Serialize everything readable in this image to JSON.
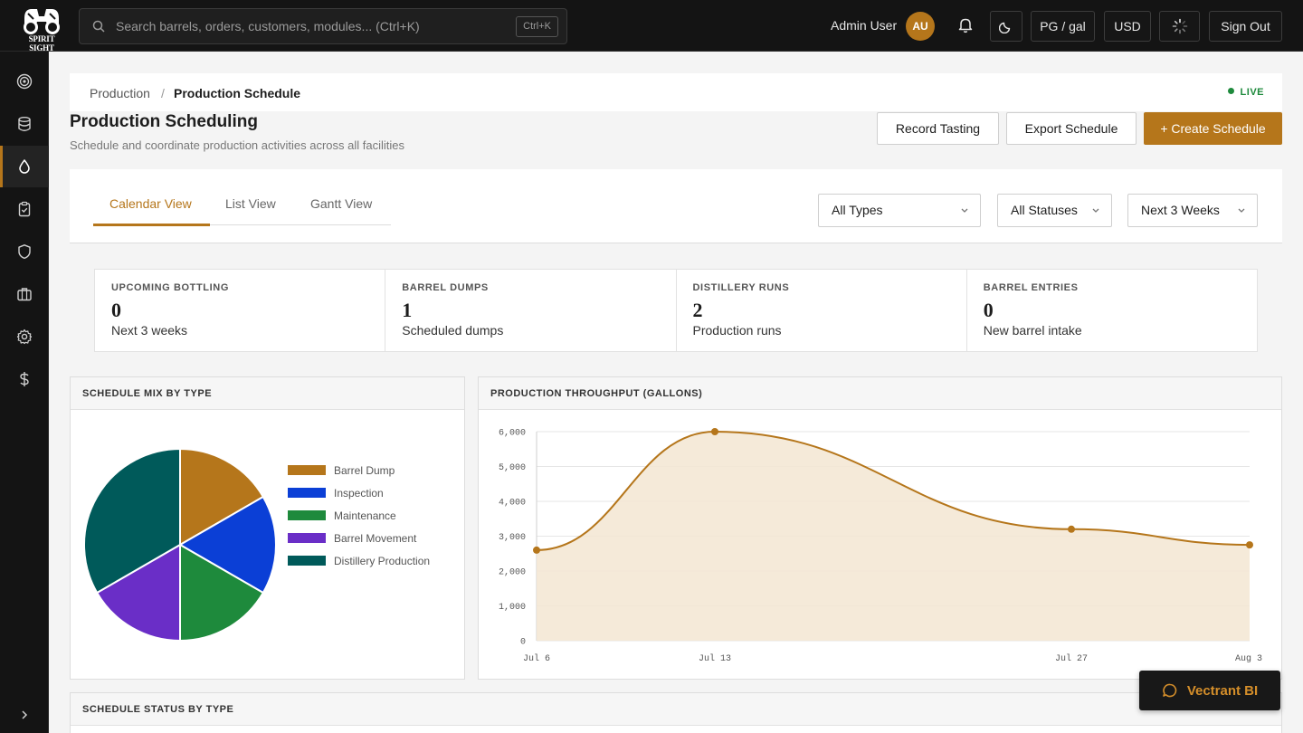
{
  "app": {
    "logo_text": "SPIRIT SIGHT",
    "search_placeholder": "Search barrels, orders, customers, modules... (Ctrl+K)",
    "search_shortcut": "Ctrl+K",
    "user_name": "Admin User",
    "user_initials": "AU",
    "unit_button": "PG / gal",
    "currency_button": "USD",
    "sign_out": "Sign Out"
  },
  "sidebar": {
    "items": [
      {
        "icon": "target-icon"
      },
      {
        "icon": "database-icon"
      },
      {
        "icon": "droplet-icon",
        "active": true
      },
      {
        "icon": "clipboard-icon"
      },
      {
        "icon": "shield-icon"
      },
      {
        "icon": "briefcase-icon"
      },
      {
        "icon": "gear-icon"
      },
      {
        "icon": "dollar-icon"
      }
    ]
  },
  "breadcrumb": {
    "parent": "Production",
    "separator": "/",
    "current": "Production Schedule",
    "live": "LIVE"
  },
  "page": {
    "title": "Production Scheduling",
    "subtitle": "Schedule and coordinate production activities across all facilities",
    "actions": {
      "record_tasting": "Record Tasting",
      "export_schedule": "Export Schedule",
      "create_schedule": "+ Create Schedule"
    }
  },
  "views": {
    "tabs": [
      "Calendar View",
      "List View",
      "Gantt View"
    ],
    "active": "Calendar View",
    "filters": {
      "type": "All Types",
      "status": "All Statuses",
      "range": "Next 3 Weeks"
    }
  },
  "stats": [
    {
      "label": "UPCOMING BOTTLING",
      "value": "0",
      "sub": "Next 3 weeks"
    },
    {
      "label": "BARREL DUMPS",
      "value": "1",
      "sub": "Scheduled dumps"
    },
    {
      "label": "DISTILLERY RUNS",
      "value": "2",
      "sub": "Production runs"
    },
    {
      "label": "BARREL ENTRIES",
      "value": "0",
      "sub": "New barrel intake"
    }
  ],
  "cards": {
    "mix_title": "SCHEDULE MIX BY TYPE",
    "throughput_title": "PRODUCTION THROUGHPUT (GALLONS)",
    "status_title": "SCHEDULE STATUS BY TYPE"
  },
  "chart_data": [
    {
      "type": "pie",
      "title": "SCHEDULE MIX BY TYPE",
      "categories": [
        "Barrel Dump",
        "Inspection",
        "Maintenance",
        "Barrel Movement",
        "Distillery Production"
      ],
      "values": [
        1,
        1,
        1,
        1,
        2
      ],
      "colors": [
        "#b5761b",
        "#0b3fd6",
        "#1e8a3c",
        "#6a2ec7",
        "#005a5a"
      ],
      "legend": "right"
    },
    {
      "type": "area",
      "title": "PRODUCTION THROUGHPUT (GALLONS)",
      "x": [
        "Jul 6",
        "Jul 13",
        "Jul 27",
        "Aug 3"
      ],
      "values": [
        2600,
        6000,
        3200,
        2750
      ],
      "ylim": [
        0,
        6000
      ],
      "yticks": [
        "6,000",
        "5,000",
        "4,000",
        "3,000",
        "2,000",
        "1,000",
        "0"
      ],
      "color": "#b5761b",
      "grid": true
    }
  ],
  "chat": {
    "label": "Vectrant BI"
  }
}
